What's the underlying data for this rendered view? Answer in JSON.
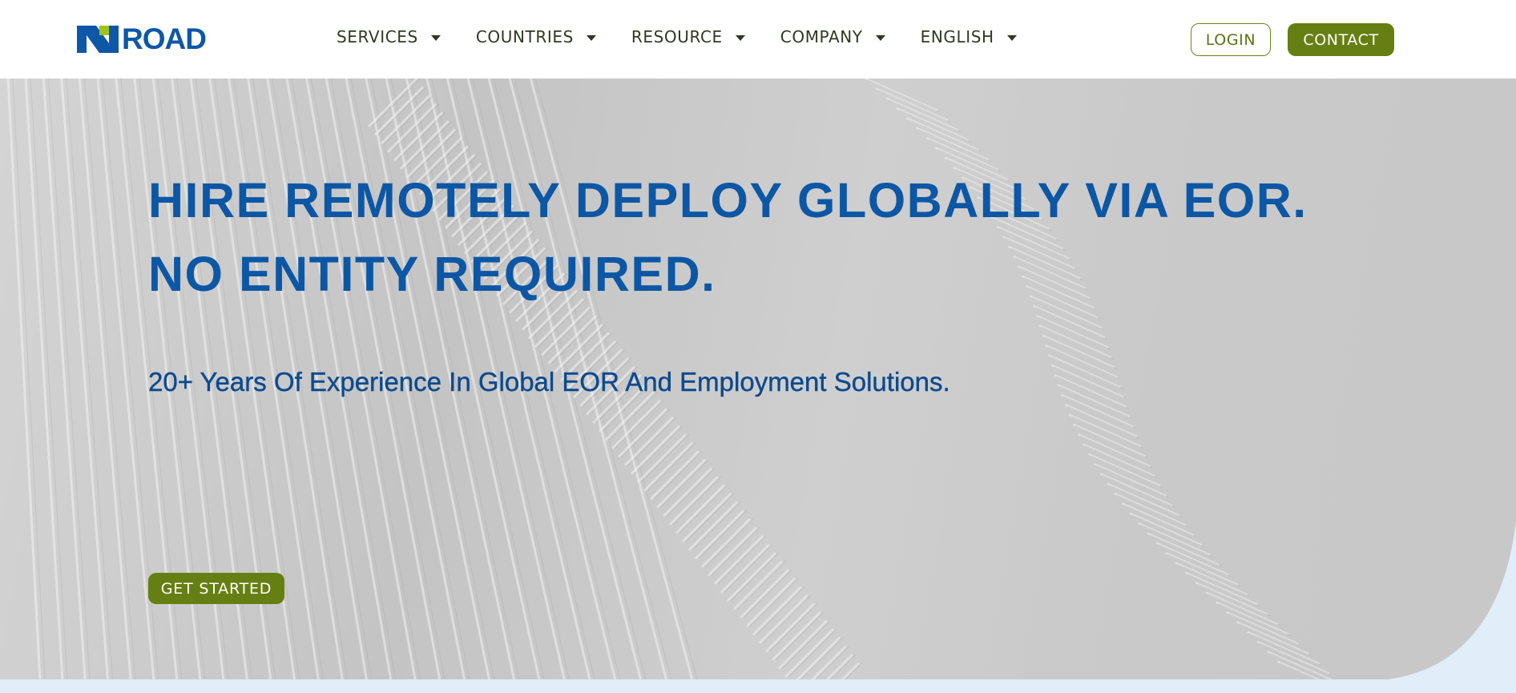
{
  "brand": {
    "logo_text": "ROAD",
    "logo_mark": "n-shape-logo-mark",
    "colors": {
      "blue": "#0e57a8",
      "green": "#667f12",
      "lime": "#9fc31a"
    }
  },
  "nav": {
    "items": [
      {
        "label": "SERVICES",
        "icon": "caret-down-icon"
      },
      {
        "label": "COUNTRIES",
        "icon": "caret-down-icon"
      },
      {
        "label": "RESOURCE",
        "icon": "caret-down-icon"
      },
      {
        "label": "COMPANY",
        "icon": "caret-down-icon"
      },
      {
        "label": "ENGLISH",
        "icon": "caret-down-icon"
      }
    ],
    "login_label": "LOGIN",
    "contact_label": "CONTACT"
  },
  "hero": {
    "title_line1": "HIRE REMOTELY DEPLOY GLOBALLY VIA EOR.",
    "title_line2": "NO ENTITY REQUIRED.",
    "subtitle": "20+ Years Of Experience In Global EOR And Employment Solutions.",
    "cta_label": "GET STARTED",
    "background": "white-architectural-fins-image",
    "title_color": "#0c57a5",
    "subtitle_color": "#0c4a8e"
  }
}
